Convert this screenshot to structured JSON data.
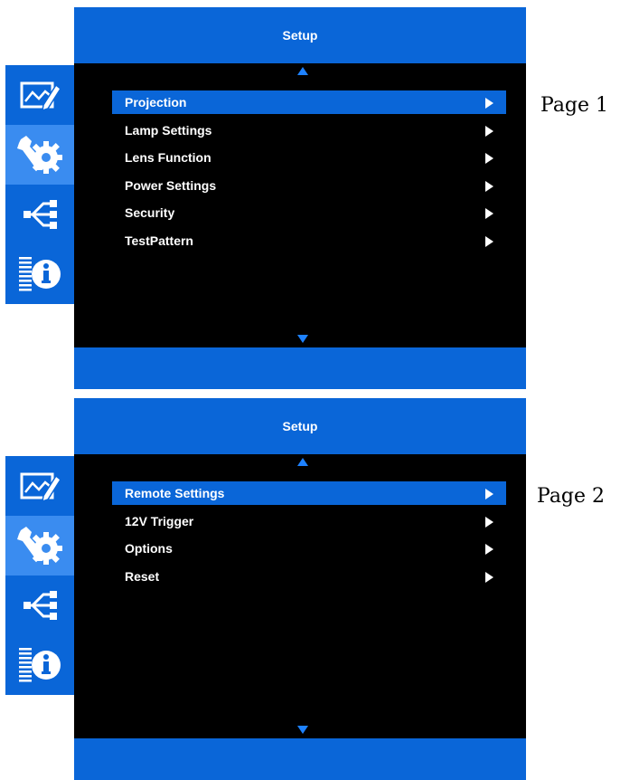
{
  "pages": [
    {
      "label": "Page 1",
      "title": "Setup",
      "selected_index": 0,
      "items": [
        "Projection",
        "Lamp Settings",
        "Lens Function",
        "Power Settings",
        "Security",
        "TestPattern"
      ]
    },
    {
      "label": "Page 2",
      "title": "Setup",
      "selected_index": 0,
      "items": [
        "Remote Settings",
        "12V Trigger",
        "Options",
        "Reset"
      ]
    }
  ],
  "side_nav": {
    "tabs": [
      {
        "icon": "image-edit-icon",
        "active": false
      },
      {
        "icon": "wrench-gear-icon",
        "active": true
      },
      {
        "icon": "usb-network-icon",
        "active": false
      },
      {
        "icon": "info-icon",
        "active": false
      }
    ]
  },
  "colors": {
    "osd_blue": "#0a66d8",
    "active_tab": "#3a8cf0",
    "scroll_arrow": "#1e82ff",
    "menu_background": "#000000",
    "text": "#ffffff"
  }
}
